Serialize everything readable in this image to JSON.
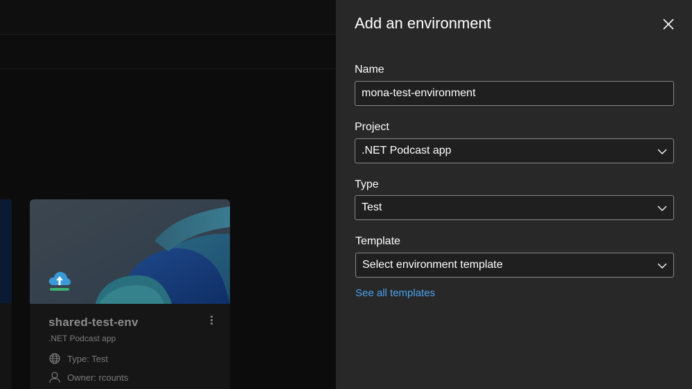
{
  "panel": {
    "title": "Add an environment",
    "close_icon": "close-icon"
  },
  "form": {
    "name": {
      "label": "Name",
      "value": "mona-test-environment"
    },
    "project": {
      "label": "Project",
      "value": ".NET Podcast app"
    },
    "type": {
      "label": "Type",
      "value": "Test"
    },
    "template": {
      "label": "Template",
      "placeholder": "Select environment template"
    },
    "see_all_link": "See all templates"
  },
  "background_card": {
    "title": "shared-test-env",
    "project": ".NET Podcast app",
    "type_text": "Type: Test",
    "owner_text": "Owner: rcounts",
    "icons": [
      "cloud-upload-icon",
      "globe-icon",
      "person-icon",
      "more-vertical-icon"
    ]
  },
  "colors": {
    "panel_bg": "#282828",
    "page_bg": "#0c0c0c",
    "link": "#4aa3f0",
    "field_border": "#8a8a8a"
  }
}
